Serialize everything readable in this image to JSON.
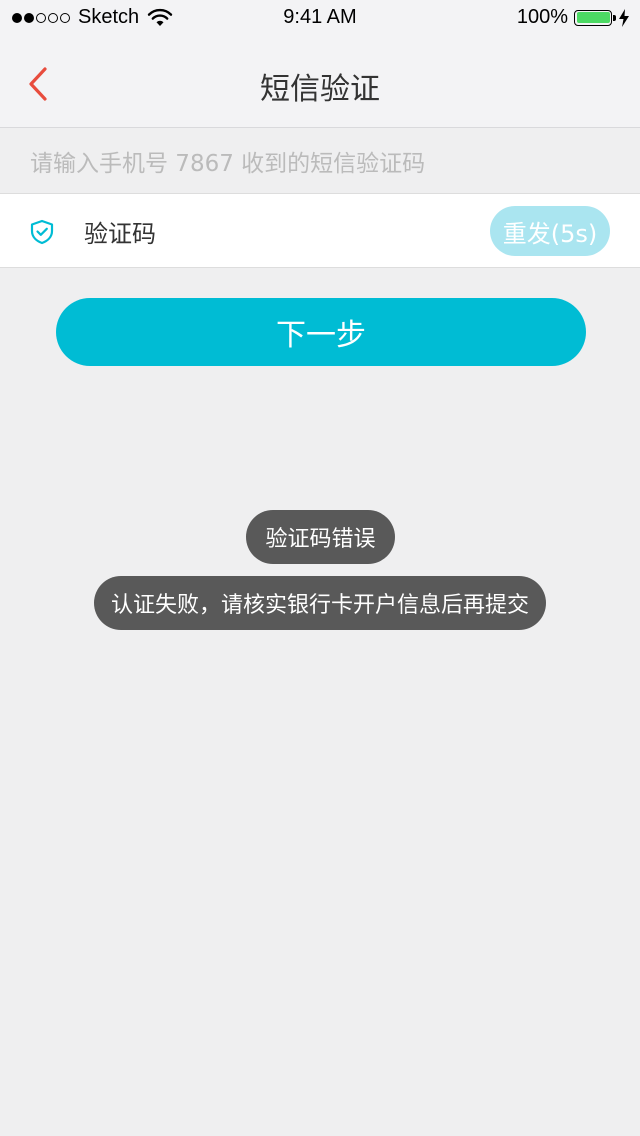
{
  "status_bar": {
    "carrier": "Sketch",
    "time": "9:41 AM",
    "battery": "100%",
    "signal_strength": 2,
    "signal_total": 5
  },
  "nav": {
    "title": "短信验证",
    "back_icon": "chevron-left-icon"
  },
  "hint": {
    "text": "请输入手机号 7867 收到的短信验证码"
  },
  "code_row": {
    "icon": "shield-check-icon",
    "label": "验证码",
    "resend_label": "重发(5s)"
  },
  "next_button": {
    "label": "下一步"
  },
  "toasts": {
    "first": "验证码错误",
    "second": "认证失败，请核实银行卡开户信息后再提交"
  },
  "colors": {
    "accent": "#00bcd4",
    "accent_light": "#aae5f0",
    "back_arrow": "#e84c3d",
    "battery": "#4cd964",
    "toast_bg": "#595959"
  }
}
